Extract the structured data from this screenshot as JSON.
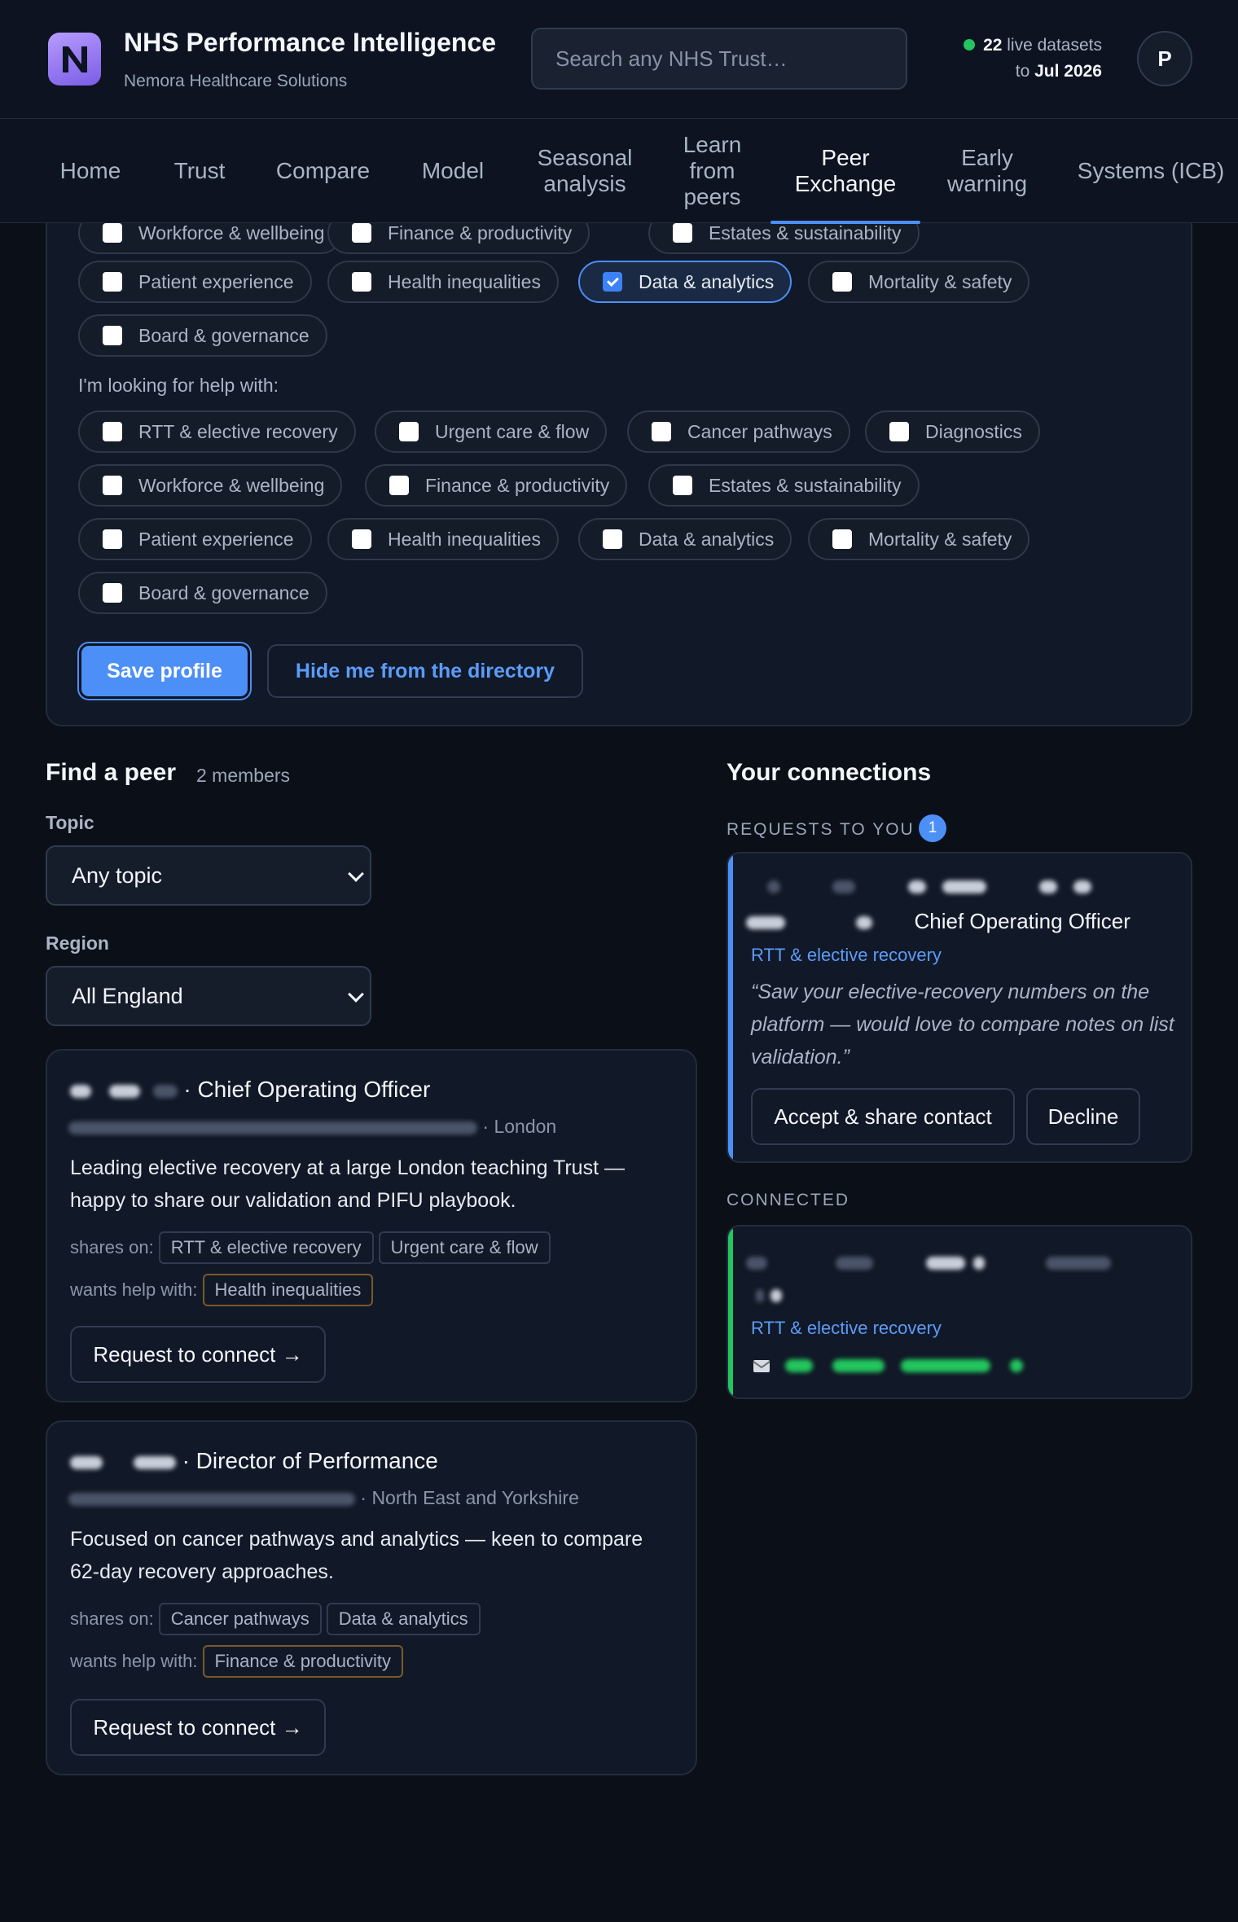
{
  "header": {
    "title": "NHS Performance Intelligence",
    "subtitle": "Nemora Healthcare Solutions",
    "search_placeholder": "Search any NHS Trust…",
    "live_count": "22",
    "live_label": "live datasets",
    "live_to": "to",
    "live_date": "Jul 2026",
    "avatar_initial": "P",
    "brand_color": "#8b6cf0"
  },
  "nav": {
    "items": [
      {
        "label": "Home"
      },
      {
        "label": "Trust"
      },
      {
        "label": "Compare"
      },
      {
        "label": "Model"
      },
      {
        "label": "Seasonal analysis"
      },
      {
        "label": "Learn from peers"
      },
      {
        "label": "Peer Exchange",
        "active": true
      },
      {
        "label": "Early warning"
      },
      {
        "label": "Systems (ICB)"
      }
    ]
  },
  "profile": {
    "offer_topics": [
      {
        "label": "Workforce & wellbeing",
        "checked": false
      },
      {
        "label": "Finance & productivity",
        "checked": false
      },
      {
        "label": "Estates & sustainability",
        "checked": false
      },
      {
        "label": "Patient experience",
        "checked": false
      },
      {
        "label": "Health inequalities",
        "checked": false
      },
      {
        "label": "Data & analytics",
        "checked": true
      },
      {
        "label": "Mortality & safety",
        "checked": false
      },
      {
        "label": "Board & governance",
        "checked": false
      }
    ],
    "help_label": "I'm looking for help with:",
    "help_topics": [
      {
        "label": "RTT & elective recovery",
        "checked": false
      },
      {
        "label": "Urgent care & flow",
        "checked": false
      },
      {
        "label": "Cancer pathways",
        "checked": false
      },
      {
        "label": "Diagnostics",
        "checked": false
      },
      {
        "label": "Workforce & wellbeing",
        "checked": false
      },
      {
        "label": "Finance & productivity",
        "checked": false
      },
      {
        "label": "Estates & sustainability",
        "checked": false
      },
      {
        "label": "Patient experience",
        "checked": false
      },
      {
        "label": "Health inequalities",
        "checked": false
      },
      {
        "label": "Data & analytics",
        "checked": false
      },
      {
        "label": "Mortality & safety",
        "checked": false
      },
      {
        "label": "Board & governance",
        "checked": false
      }
    ],
    "save_label": "Save profile",
    "hide_label": "Hide me from the directory"
  },
  "find": {
    "title": "Find a peer",
    "count": "2 members",
    "topic_label": "Topic",
    "topic_value": "Any topic",
    "region_label": "Region",
    "region_value": "All England",
    "shares_label": "shares on:",
    "wants_label": "wants help with:",
    "connect_label": "Request to connect →",
    "peers": [
      {
        "role": "· Chief Operating Officer",
        "region": "· London",
        "bio": "Leading elective recovery at a large London teaching Trust — happy to share our validation and PIFU playbook.",
        "shares": [
          "RTT & elective recovery",
          "Urgent care & flow"
        ],
        "wants": [
          "Health inequalities"
        ]
      },
      {
        "role": "· Director of Performance",
        "region": "· North East and Yorkshire",
        "bio": "Focused on cancer pathways and analytics — keen to compare 62-day recovery approaches.",
        "shares": [
          "Cancer pathways",
          "Data & analytics"
        ],
        "wants": [
          "Finance & productivity"
        ]
      }
    ]
  },
  "connections": {
    "title": "Your connections",
    "requests_label": "REQUESTS TO YOU",
    "requests_count": "1",
    "request": {
      "role": "Chief Operating Officer",
      "topic": "RTT & elective recovery",
      "message": "“Saw your elective-recovery numbers on the platform — would love to compare notes on list validation.”",
      "accept_label": "Accept & share contact",
      "decline_label": "Decline"
    },
    "connected_label": "CONNECTED",
    "connected": {
      "topic": "RTT & elective recovery",
      "contact_icon": "envelope-icon"
    },
    "request_accent": "#4c8ff7",
    "connected_accent": "#22c55e"
  }
}
